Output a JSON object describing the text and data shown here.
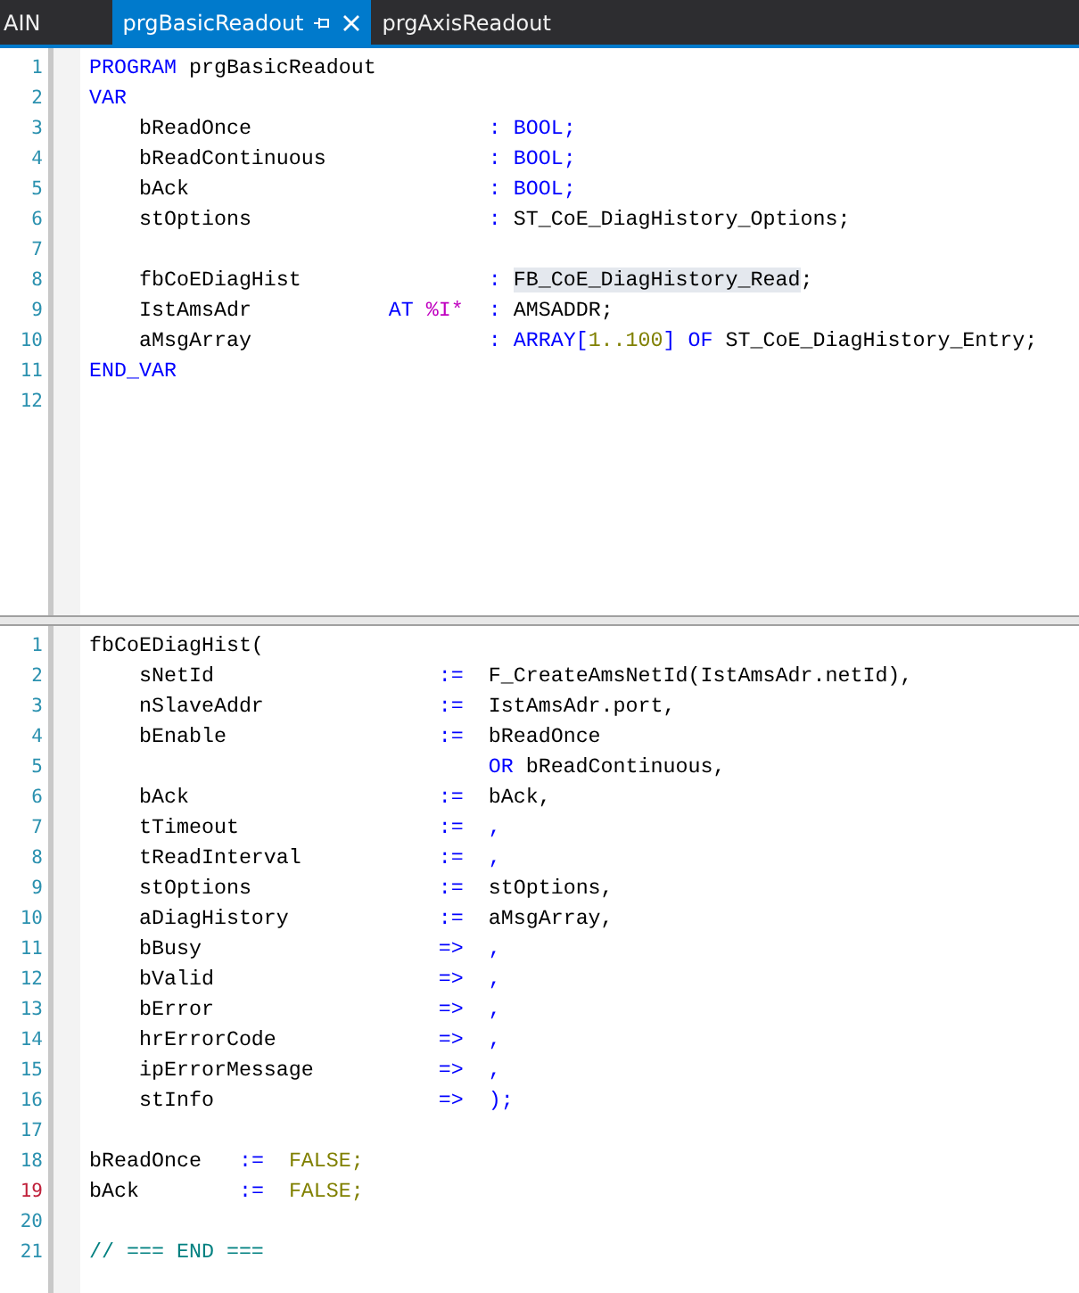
{
  "tabs": [
    {
      "label": "AIN",
      "selected": false,
      "pinned": false,
      "closable": false
    },
    {
      "label": "prgBasicReadout",
      "selected": true,
      "pinned": true,
      "closable": true
    },
    {
      "label": "prgAxisReadout",
      "selected": false,
      "pinned": false,
      "closable": false
    }
  ],
  "declaration_pane": {
    "lines": [
      {
        "number": "1",
        "changed": false,
        "tokens": [
          {
            "text": "PROGRAM",
            "kind": "keyword"
          },
          {
            "text": " prgBasicReadout",
            "kind": "plain"
          }
        ]
      },
      {
        "number": "2",
        "changed": false,
        "tokens": [
          {
            "text": "VAR",
            "kind": "keyword"
          }
        ]
      },
      {
        "number": "3",
        "changed": false,
        "tokens": [
          {
            "text": "    bReadOnce                   ",
            "kind": "plain"
          },
          {
            "text": ": BOOL;",
            "kind": "keyword"
          }
        ]
      },
      {
        "number": "4",
        "changed": false,
        "tokens": [
          {
            "text": "    bReadContinuous             ",
            "kind": "plain"
          },
          {
            "text": ": BOOL;",
            "kind": "keyword"
          }
        ]
      },
      {
        "number": "5",
        "changed": false,
        "tokens": [
          {
            "text": "    bAck                        ",
            "kind": "plain"
          },
          {
            "text": ": BOOL;",
            "kind": "keyword"
          }
        ]
      },
      {
        "number": "6",
        "changed": false,
        "tokens": [
          {
            "text": "    stOptions                   ",
            "kind": "plain"
          },
          {
            "text": ": ",
            "kind": "keyword"
          },
          {
            "text": "ST_CoE_DiagHistory_Options;",
            "kind": "plain"
          }
        ]
      },
      {
        "number": "7",
        "changed": false
      },
      {
        "number": "8",
        "changed": false,
        "tokens": [
          {
            "text": "    fbCoEDiagHist               ",
            "kind": "plain"
          },
          {
            "text": ": ",
            "kind": "keyword"
          },
          {
            "text": "FB_CoE_DiagHistory_Read",
            "kind": "match"
          },
          {
            "text": ";",
            "kind": "plain"
          }
        ]
      },
      {
        "number": "9",
        "changed": false,
        "tokens": [
          {
            "text": "    IstAmsAdr           ",
            "kind": "plain"
          },
          {
            "text": "AT ",
            "kind": "keyword"
          },
          {
            "text": "%I*",
            "kind": "address"
          },
          {
            "text": "  : ",
            "kind": "keyword"
          },
          {
            "text": "AMSADDR;",
            "kind": "plain"
          }
        ]
      },
      {
        "number": "10",
        "changed": false,
        "tokens": [
          {
            "text": "    aMsgArray                   ",
            "kind": "plain"
          },
          {
            "text": ": ARRAY[",
            "kind": "keyword"
          },
          {
            "text": "1..100",
            "kind": "literal"
          },
          {
            "text": "] OF ",
            "kind": "keyword"
          },
          {
            "text": "ST_CoE_DiagHistory_Entry;",
            "kind": "plain"
          }
        ]
      },
      {
        "number": "11",
        "changed": false,
        "tokens": [
          {
            "text": "END_VAR",
            "kind": "keyword"
          }
        ]
      },
      {
        "number": "12",
        "changed": false
      }
    ]
  },
  "implementation_pane": {
    "lines": [
      {
        "number": "1",
        "changed": false,
        "tokens": [
          {
            "text": "fbCoEDiagHist(",
            "kind": "plain"
          }
        ]
      },
      {
        "number": "2",
        "changed": false,
        "tokens": [
          {
            "text": "    sNetId                  ",
            "kind": "plain"
          },
          {
            "text": ":=",
            "kind": "keyword"
          },
          {
            "text": "  F_CreateAmsNetId(IstAmsAdr.netId),",
            "kind": "plain"
          }
        ]
      },
      {
        "number": "3",
        "changed": false,
        "tokens": [
          {
            "text": "    nSlaveAddr              ",
            "kind": "plain"
          },
          {
            "text": ":=",
            "kind": "keyword"
          },
          {
            "text": "  IstAmsAdr.port,",
            "kind": "plain"
          }
        ]
      },
      {
        "number": "4",
        "changed": false,
        "tokens": [
          {
            "text": "    bEnable                 ",
            "kind": "plain"
          },
          {
            "text": ":=",
            "kind": "keyword"
          },
          {
            "text": "  bReadOnce",
            "kind": "plain"
          }
        ]
      },
      {
        "number": "5",
        "changed": false,
        "tokens": [
          {
            "text": "                                OR",
            "kind": "keyword"
          },
          {
            "text": " bReadContinuous,",
            "kind": "plain"
          }
        ]
      },
      {
        "number": "6",
        "changed": false,
        "tokens": [
          {
            "text": "    bAck                    ",
            "kind": "plain"
          },
          {
            "text": ":=",
            "kind": "keyword"
          },
          {
            "text": "  bAck,",
            "kind": "plain"
          }
        ]
      },
      {
        "number": "7",
        "changed": false,
        "tokens": [
          {
            "text": "    tTimeout                ",
            "kind": "plain"
          },
          {
            "text": ":=  ,",
            "kind": "keyword"
          }
        ]
      },
      {
        "number": "8",
        "changed": false,
        "tokens": [
          {
            "text": "    tReadInterval           ",
            "kind": "plain"
          },
          {
            "text": ":=  ,",
            "kind": "keyword"
          }
        ]
      },
      {
        "number": "9",
        "changed": false,
        "tokens": [
          {
            "text": "    stOptions               ",
            "kind": "plain"
          },
          {
            "text": ":=",
            "kind": "keyword"
          },
          {
            "text": "  stOptions,",
            "kind": "plain"
          }
        ]
      },
      {
        "number": "10",
        "changed": false,
        "tokens": [
          {
            "text": "    aDiagHistory            ",
            "kind": "plain"
          },
          {
            "text": ":=",
            "kind": "keyword"
          },
          {
            "text": "  aMsgArray,",
            "kind": "plain"
          }
        ]
      },
      {
        "number": "11",
        "changed": false,
        "tokens": [
          {
            "text": "    bBusy                   ",
            "kind": "plain"
          },
          {
            "text": "=>  ,",
            "kind": "keyword"
          }
        ]
      },
      {
        "number": "12",
        "changed": false,
        "tokens": [
          {
            "text": "    bValid                  ",
            "kind": "plain"
          },
          {
            "text": "=>  ,",
            "kind": "keyword"
          }
        ]
      },
      {
        "number": "13",
        "changed": false,
        "tokens": [
          {
            "text": "    bError                  ",
            "kind": "plain"
          },
          {
            "text": "=>  ,",
            "kind": "keyword"
          }
        ]
      },
      {
        "number": "14",
        "changed": false,
        "tokens": [
          {
            "text": "    hrErrorCode             ",
            "kind": "plain"
          },
          {
            "text": "=>  ,",
            "kind": "keyword"
          }
        ]
      },
      {
        "number": "15",
        "changed": false,
        "tokens": [
          {
            "text": "    ipErrorMessage          ",
            "kind": "plain"
          },
          {
            "text": "=>  ,",
            "kind": "keyword"
          }
        ]
      },
      {
        "number": "16",
        "changed": false,
        "tokens": [
          {
            "text": "    stInfo                  ",
            "kind": "plain"
          },
          {
            "text": "=>  );",
            "kind": "keyword"
          }
        ]
      },
      {
        "number": "17",
        "changed": false
      },
      {
        "number": "18",
        "changed": false,
        "tokens": [
          {
            "text": "bReadOnce   ",
            "kind": "plain"
          },
          {
            "text": ":=  ",
            "kind": "keyword"
          },
          {
            "text": "FALSE;",
            "kind": "literal"
          }
        ]
      },
      {
        "number": "19",
        "changed": true,
        "tokens": [
          {
            "text": "bAck        ",
            "kind": "plain"
          },
          {
            "text": ":=  ",
            "kind": "keyword"
          },
          {
            "text": "FALSE;",
            "kind": "literal"
          }
        ]
      },
      {
        "number": "20",
        "changed": false
      },
      {
        "number": "21",
        "changed": false,
        "tokens": [
          {
            "text": "// === END ===",
            "kind": "comment"
          }
        ]
      }
    ]
  }
}
